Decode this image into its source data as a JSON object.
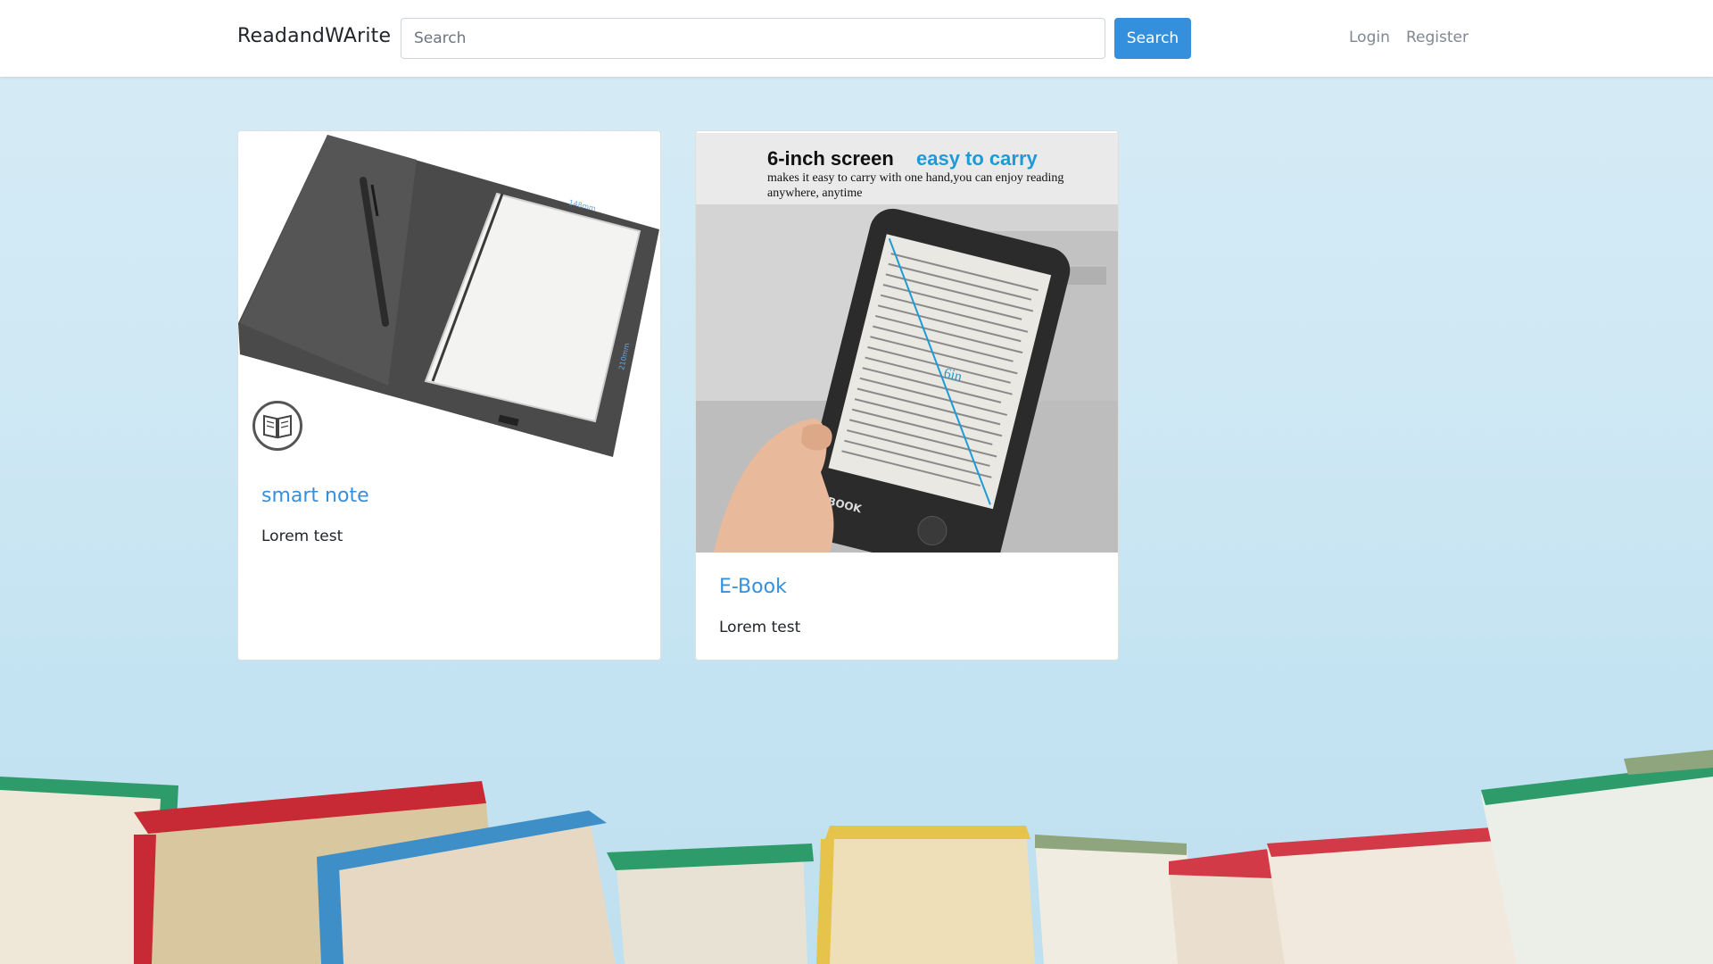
{
  "navbar": {
    "brand": "ReadandWArite",
    "search_placeholder": "Search",
    "search_button": "Search",
    "login": "Login",
    "register": "Register"
  },
  "cards": [
    {
      "title": "smart note",
      "text": "Lorem test",
      "image_icon": "notebook-tablet-image"
    },
    {
      "title": "E-Book",
      "text": "Lorem test",
      "image_icon": "ebook-reader-image",
      "banner_title": "6-inch screen",
      "banner_title_accent": "easy to carry",
      "banner_subtitle": "makes it easy to carry with one hand,you can enjoy reading anywhere, anytime",
      "device_label": "E-BOOK",
      "size_label": "6in"
    }
  ],
  "colors": {
    "primary": "#3490dc",
    "background": "#cfe8f4",
    "text": "#212529",
    "muted": "#7f8790"
  }
}
